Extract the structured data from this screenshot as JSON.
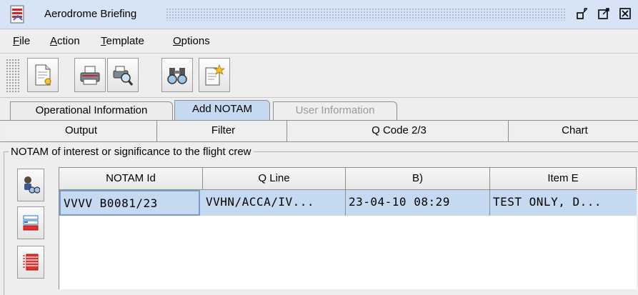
{
  "window": {
    "title": "Aerodrome Briefing",
    "controls": [
      "restore-icon",
      "maximize-icon",
      "close-icon"
    ]
  },
  "menu": [
    {
      "prefix": "",
      "mnemonic": "F",
      "suffix": "ile"
    },
    {
      "prefix": "",
      "mnemonic": "A",
      "suffix": "ction"
    },
    {
      "prefix": "",
      "mnemonic": "T",
      "suffix": "emplate"
    },
    {
      "prefix": "",
      "mnemonic": "O",
      "suffix": "ptions"
    }
  ],
  "toolbar": {
    "buttons": [
      "new-document-icon",
      "print-icon",
      "print-preview-icon",
      "binoculars-icon",
      "new-template-icon"
    ]
  },
  "tabs_top": [
    {
      "label": "Operational Information",
      "state": "normal"
    },
    {
      "label": "Add NOTAM",
      "state": "active"
    },
    {
      "label": "User Information",
      "state": "disabled"
    }
  ],
  "tabs_bottom": [
    "Output",
    "Filter",
    "Q Code 2/3",
    "Chart"
  ],
  "panel": {
    "legend": "NOTAM of interest or significance to the flight crew"
  },
  "side_buttons": [
    "search-person-icon",
    "list-arrow-icon",
    "list-select-icon"
  ],
  "table": {
    "columns": [
      "NOTAM Id",
      "Q Line",
      "B)",
      "Item E"
    ],
    "rows": [
      {
        "id": "VVVV B0081/23",
        "q_line": "VVHN/ACCA/IV...",
        "b": "23-04-10 08:29",
        "item_e": "TEST ONLY, D..."
      }
    ]
  },
  "colors": {
    "titlebar": "#d7e4f5",
    "selection": "#c5d9f1",
    "background": "#eeeeee"
  }
}
